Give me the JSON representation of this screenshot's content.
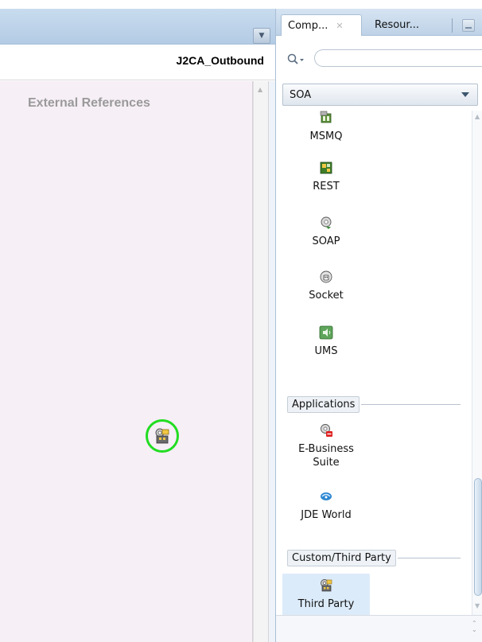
{
  "editor": {
    "title": "J2CA_Outbound",
    "canvas_heading": "External References",
    "node_icon": "third-party-adapter-icon"
  },
  "palette": {
    "tabs": [
      {
        "label": "Comp...",
        "active": true
      },
      {
        "label": "Resour...",
        "active": false
      }
    ],
    "search": {
      "placeholder": "",
      "value": ""
    },
    "category": "SOA",
    "items_top": [
      {
        "label": "MSMQ",
        "icon": "msmq-icon"
      },
      {
        "label": "REST",
        "icon": "rest-icon"
      },
      {
        "label": "SOAP",
        "icon": "soap-icon"
      },
      {
        "label": "Socket",
        "icon": "socket-icon"
      },
      {
        "label": "UMS",
        "icon": "ums-icon"
      }
    ],
    "groups": [
      {
        "label": "Applications",
        "items": [
          {
            "label_line1": "E-Business",
            "label_line2": "Suite",
            "icon": "e-business-suite-icon"
          },
          {
            "label": "JDE World",
            "icon": "jde-world-icon"
          }
        ]
      },
      {
        "label": "Custom/Third Party",
        "items": [
          {
            "label": "Third Party",
            "icon": "third-party-icon",
            "selected": true
          }
        ]
      }
    ]
  },
  "colors": {
    "canvas_bg": "#f6eff6",
    "node_ring": "#22dd22",
    "header_blue": "#c9dcef",
    "selected_item_bg": "#dcebfa"
  }
}
